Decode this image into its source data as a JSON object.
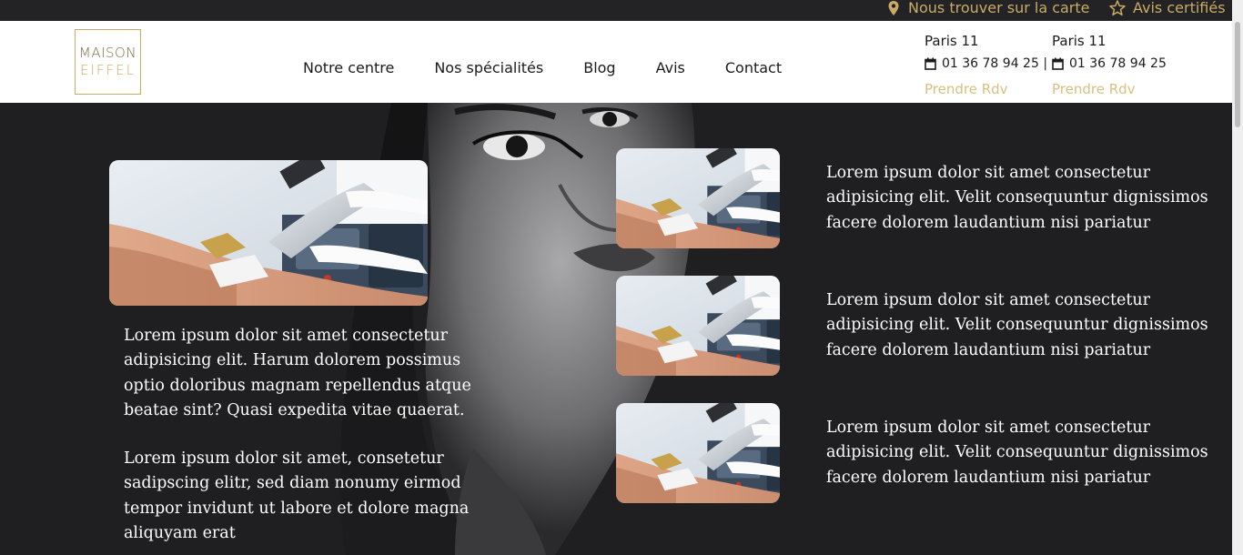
{
  "topbar": {
    "map_link": "Nous trouver sur la carte",
    "reviews_link": "Avis certifiés",
    "accent": "#c9ab66"
  },
  "logo": {
    "line1": "MAISON",
    "line2": "EIFFEL"
  },
  "nav": {
    "items": [
      "Notre centre",
      "Nos spécialités",
      "Blog",
      "Avis",
      "Contact"
    ]
  },
  "contacts": [
    {
      "city": "Paris 11",
      "phone": "01 36 78 94 25 |",
      "cta": "Prendre Rdv"
    },
    {
      "city": "Paris 11",
      "phone": "01 36 78 94 25",
      "cta": "Prendre Rdv"
    }
  ],
  "hero": {
    "left_paragraph_1": "Lorem ipsum dolor sit amet consectetur adipisicing elit. Harum dolorem possimus optio doloribus magnam repellendus atque beatae sint? Quasi expedita vitae quaerat.",
    "left_paragraph_2": "Lorem ipsum dolor sit amet, consetetur sadipscing elitr, sed diam nonumy eirmod tempor invidunt ut labore et dolore magna aliquyam erat",
    "features": [
      {
        "text": "Lorem ipsum dolor sit amet consectetur adipisicing elit. Velit consequuntur dignissimos facere dolorem laudantium nisi pariatur"
      },
      {
        "text": "Lorem ipsum dolor sit amet consectetur adipisicing elit. Velit consequuntur dignissimos facere dolorem laudantium nisi pariatur"
      },
      {
        "text": "Lorem ipsum dolor sit amet consectetur adipisicing elit. Velit consequuntur dignissimos facere dolorem laudantium nisi pariatur"
      }
    ]
  },
  "colors": {
    "background": "#1f1f21",
    "gold": "#c9ab66",
    "gold_light": "#d9bf80"
  }
}
